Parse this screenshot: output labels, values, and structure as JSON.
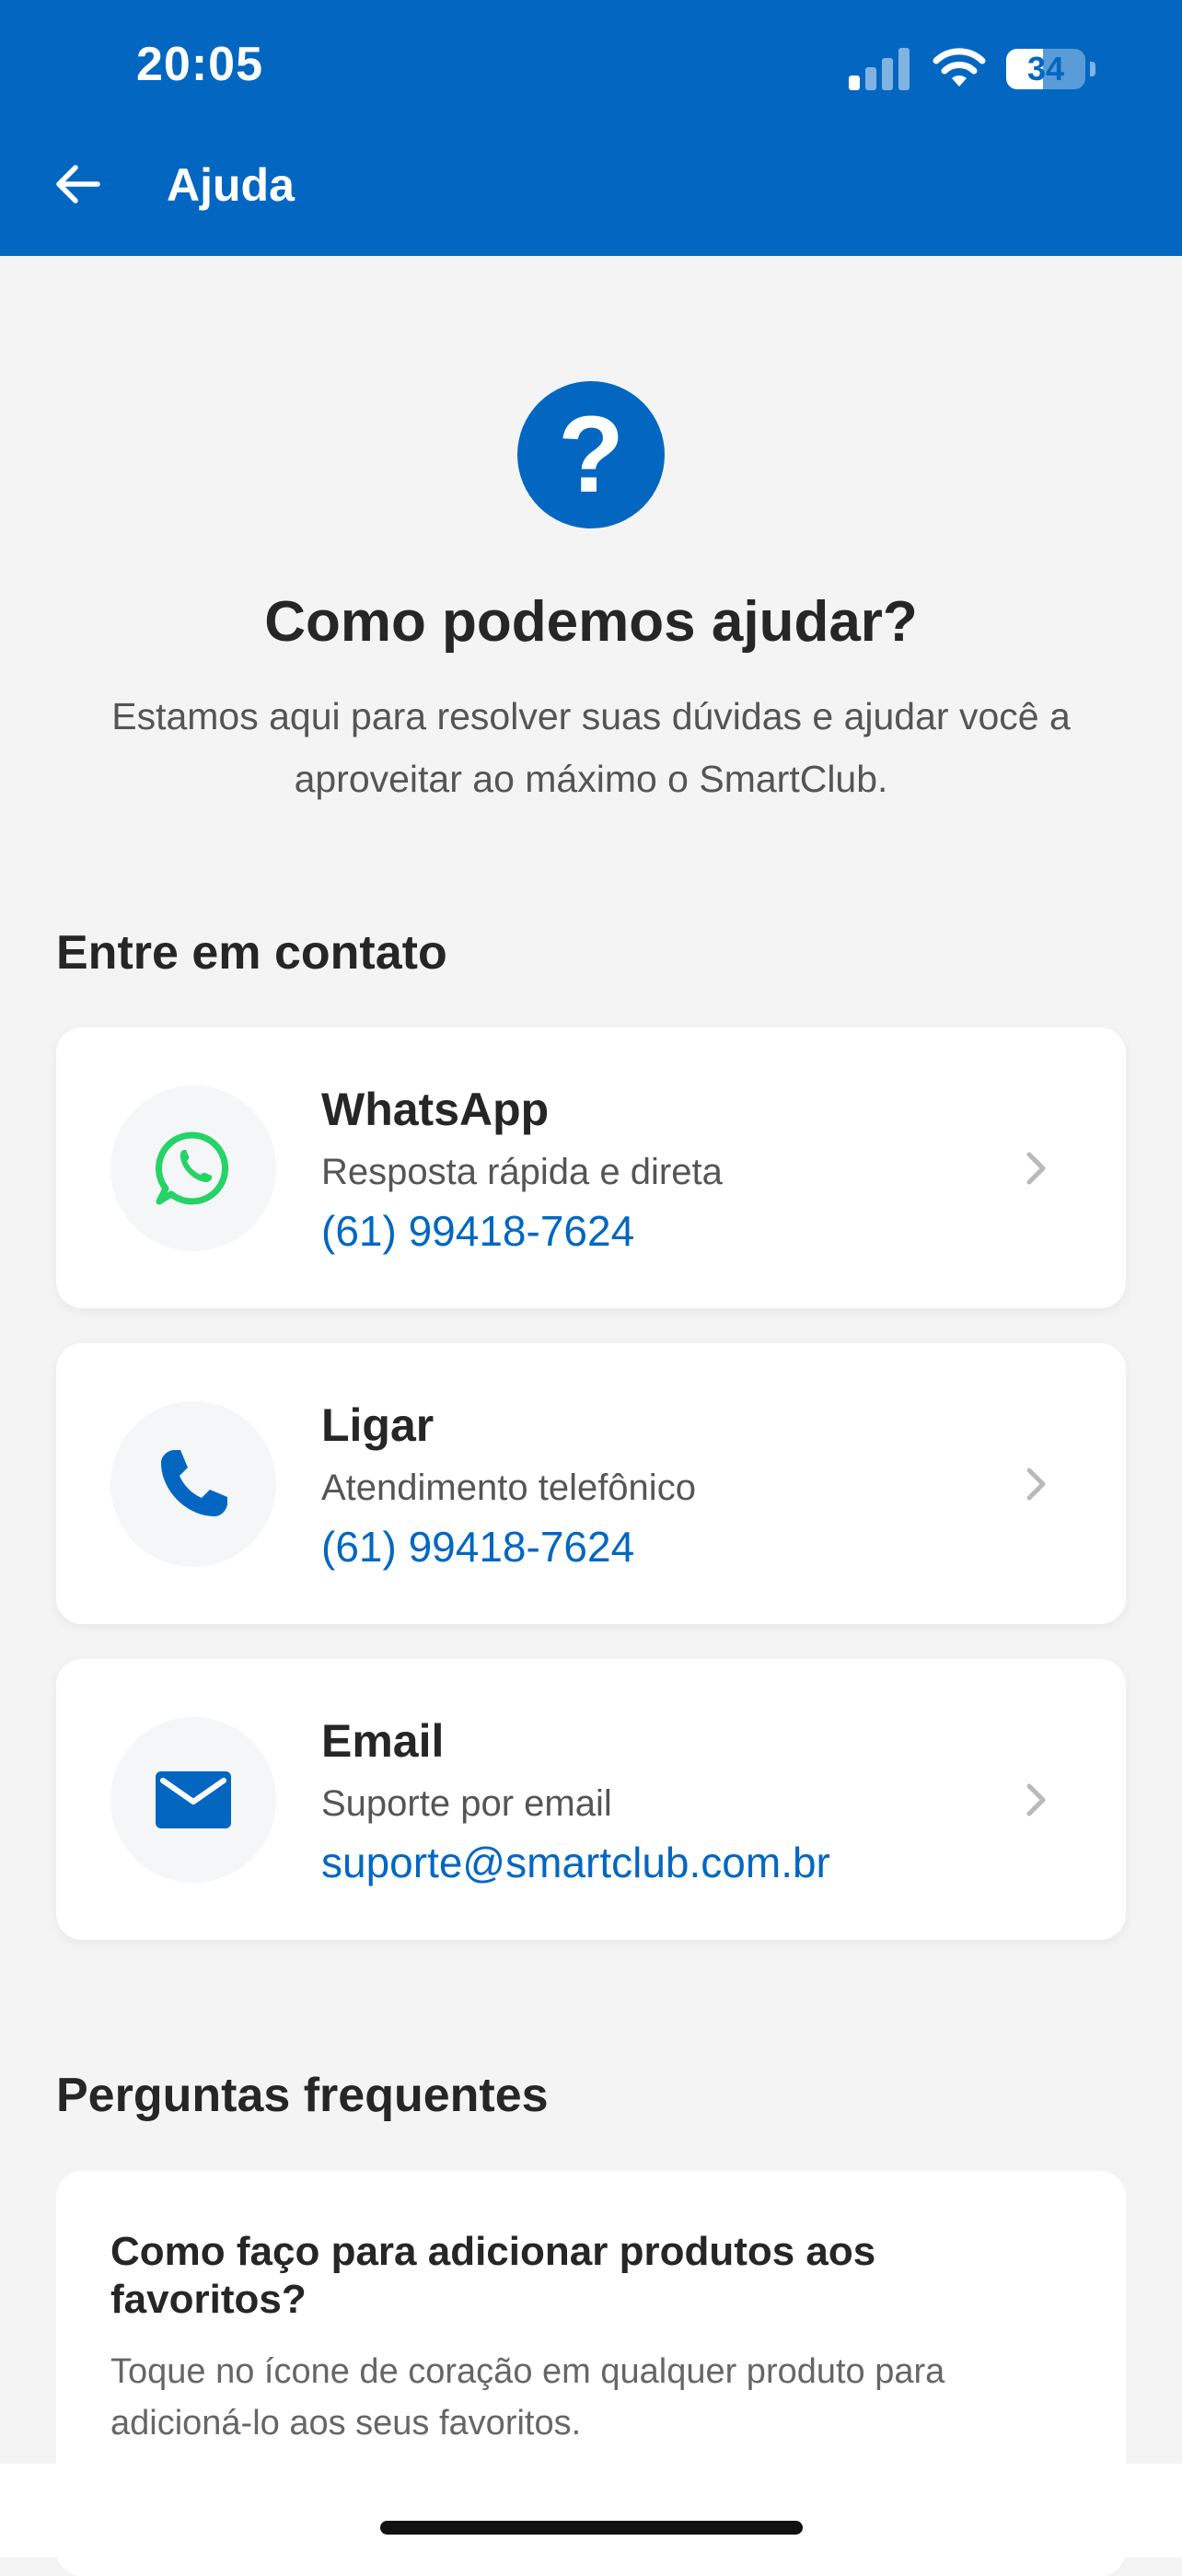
{
  "status_bar": {
    "time": "20:05",
    "battery": "34"
  },
  "header": {
    "title": "Ajuda"
  },
  "hero": {
    "icon": "?",
    "title": "Como podemos ajudar?",
    "subtitle": "Estamos aqui para resolver suas dúvidas e ajudar você a aproveitar ao máximo o SmartClub."
  },
  "contact": {
    "section_title": "Entre em contato",
    "items": [
      {
        "title": "WhatsApp",
        "subtitle": "Resposta rápida e direta",
        "value": "(61) 99418-7624",
        "icon": "whatsapp-icon"
      },
      {
        "title": "Ligar",
        "subtitle": "Atendimento telefônico",
        "value": "(61) 99418-7624",
        "icon": "phone-icon"
      },
      {
        "title": "Email",
        "subtitle": "Suporte por email",
        "value": "suporte@smartclub.com.br",
        "icon": "mail-icon"
      }
    ]
  },
  "faq": {
    "section_title": "Perguntas frequentes",
    "items": [
      {
        "question": "Como faço para adicionar produtos aos favoritos?",
        "answer": "Toque no ícone de coração em qualquer produto para adicioná-lo aos seus favoritos."
      }
    ]
  },
  "colors": {
    "primary": "#0367c2",
    "whatsapp": "#25d366",
    "background": "#f4f4f4"
  }
}
